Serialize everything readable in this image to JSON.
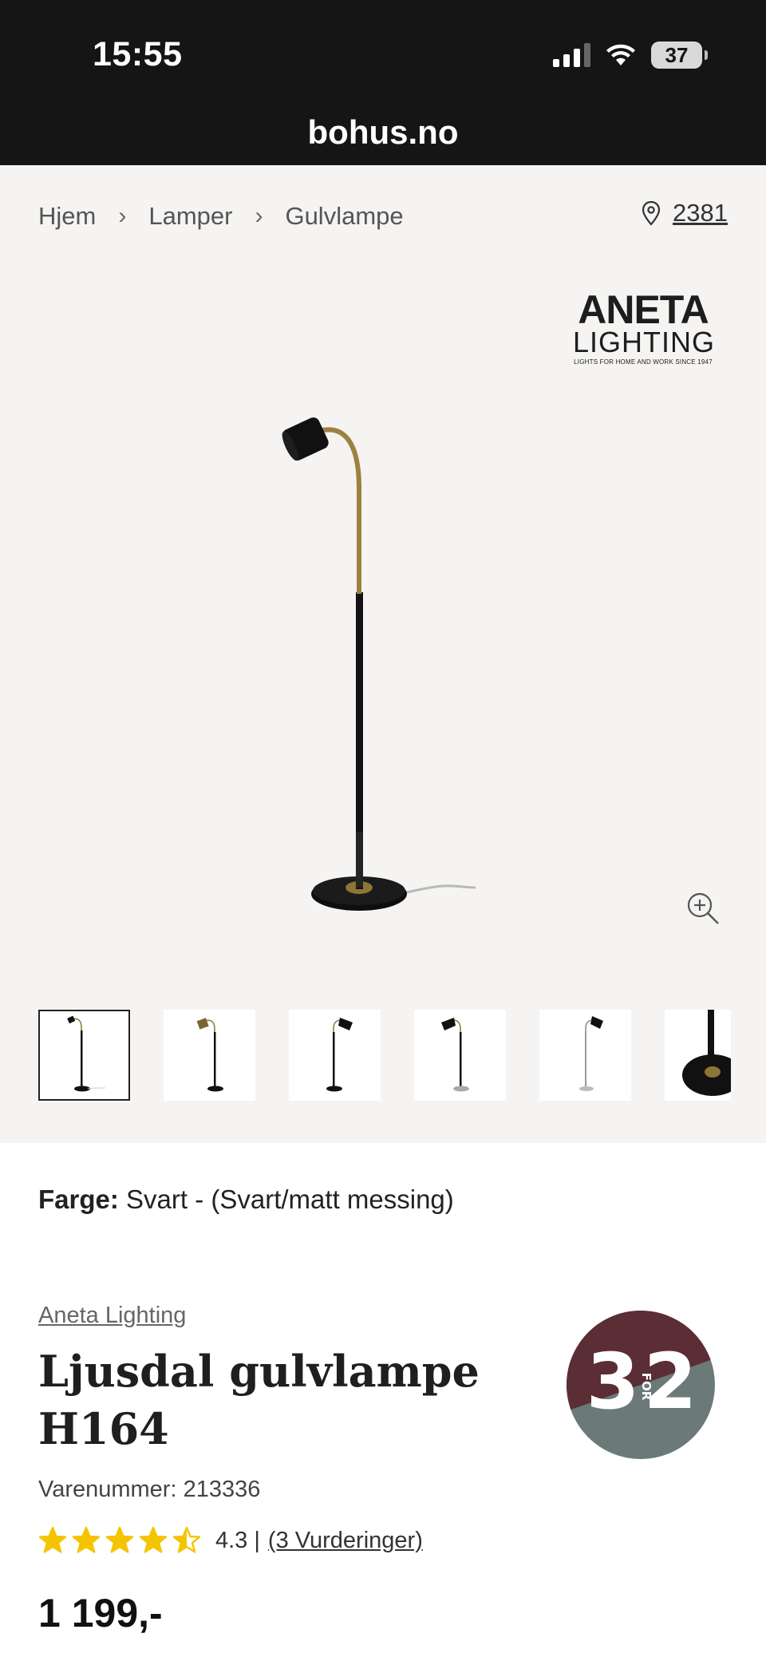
{
  "status_bar": {
    "time": "15:55",
    "battery": "37"
  },
  "browser": {
    "url": "bohus.no"
  },
  "breadcrumb": [
    {
      "label": "Hjem"
    },
    {
      "label": "Lamper"
    },
    {
      "label": "Gulvlampe"
    }
  ],
  "location": {
    "zip": "2381"
  },
  "brand_logo": {
    "line1": "ANETA",
    "line2": "LIGHTING",
    "tagline": "LIGHTS FOR HOME AND WORK SINCE 1947"
  },
  "product": {
    "color_label": "Farge:",
    "color_value": "Svart - (Svart/matt messing)",
    "brand": "Aneta Lighting",
    "title": "Ljusdal gulvlampe H164",
    "sku_text": "Varenummer: 213336",
    "rating_value": 4.3,
    "rating_text": "4.3 |",
    "reviews_text": "(3 Vurderinger)",
    "price": "1 199,-"
  },
  "badge": {
    "left": "3",
    "middle": "FOR",
    "right": "2",
    "color_top": "#5b2d35",
    "color_bottom": "#6b7a78"
  },
  "thumbnails": [
    {
      "icon": "floor-lamp-black-thumbnail",
      "active": true
    },
    {
      "icon": "floor-lamp-brass-thumbnail",
      "active": false
    },
    {
      "icon": "floor-lamp-black-thumbnail",
      "active": false
    },
    {
      "icon": "floor-lamp-grey-thumbnail",
      "active": false
    },
    {
      "icon": "floor-lamp-white-thumbnail",
      "active": false
    },
    {
      "icon": "floor-lamp-base-closeup-thumbnail",
      "active": false
    }
  ],
  "colors": {
    "header_bg": "#151515",
    "gallery_bg": "#f5f4f2",
    "star": "#f5c400"
  }
}
